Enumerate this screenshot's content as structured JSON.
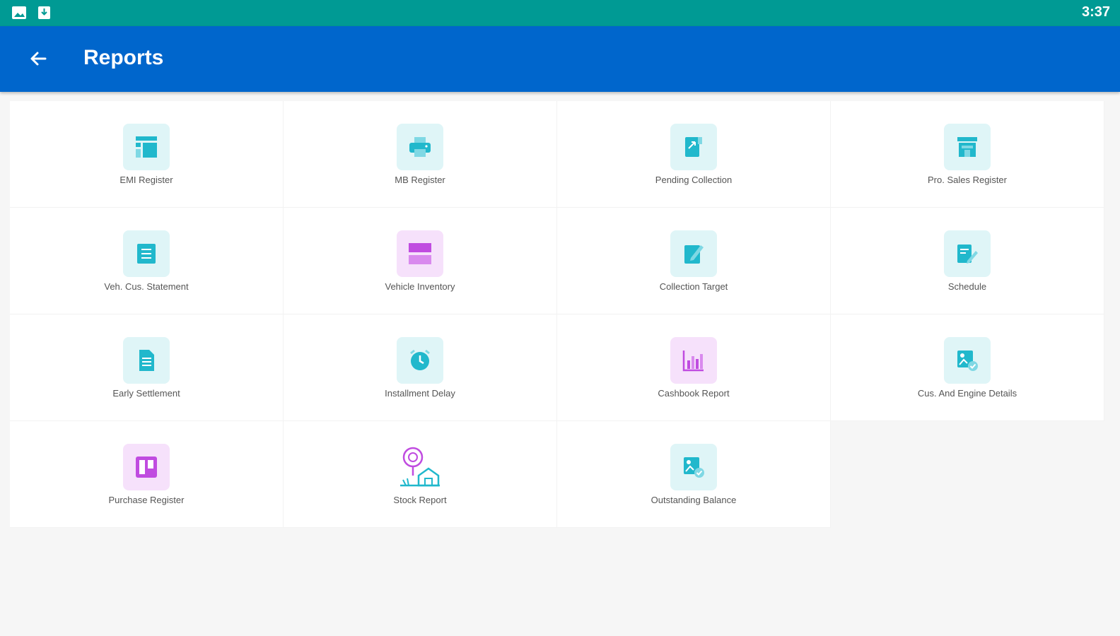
{
  "status_bar": {
    "time": "3:37",
    "icons": [
      "image-icon",
      "download-icon"
    ]
  },
  "app_bar": {
    "title": "Reports",
    "back_icon": "back-arrow-icon"
  },
  "colors": {
    "status_bar": "#009a94",
    "app_bar": "#0066cc",
    "icon_teal": "#21b8cc",
    "icon_purple": "#c04ce0"
  },
  "reports": [
    {
      "label": "EMI Register",
      "icon": "layout-icon"
    },
    {
      "label": "MB Register",
      "icon": "printer-icon"
    },
    {
      "label": "Pending Collection",
      "icon": "document-icon"
    },
    {
      "label": "Pro. Sales Register",
      "icon": "store-icon"
    },
    {
      "label": "Veh. Cus. Statement",
      "icon": "list-icon"
    },
    {
      "label": "Vehicle Inventory",
      "icon": "stack-icon"
    },
    {
      "label": "Collection Target",
      "icon": "edit-note-icon"
    },
    {
      "label": "Schedule",
      "icon": "edit-doc-icon"
    },
    {
      "label": "Early Settlement",
      "icon": "file-icon"
    },
    {
      "label": "Installment Delay",
      "icon": "clock-icon"
    },
    {
      "label": "Cashbook Report",
      "icon": "bar-chart-icon"
    },
    {
      "label": "Cus. And Engine Details",
      "icon": "verified-image-icon"
    },
    {
      "label": "Purchase Register",
      "icon": "board-icon"
    },
    {
      "label": "Stock Report",
      "icon": "warehouse-location-icon"
    },
    {
      "label": "Outstanding Balance",
      "icon": "verified-image-icon"
    }
  ]
}
